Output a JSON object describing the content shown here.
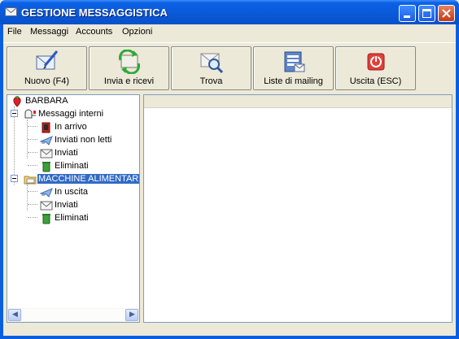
{
  "window": {
    "title": "GESTIONE MESSAGGISTICA",
    "icon": "envelope-icon",
    "controls": [
      "minimize-icon",
      "maximize-icon",
      "close-icon"
    ]
  },
  "menu": {
    "items": [
      {
        "label": "File"
      },
      {
        "label": "Messaggi"
      },
      {
        "label": "Accounts"
      },
      {
        "label": "Opzioni"
      }
    ]
  },
  "toolbar": {
    "buttons": [
      {
        "label": "Nuovo (F4)",
        "icon": "new-message-icon"
      },
      {
        "label": "Invia e ricevi",
        "icon": "send-receive-icon"
      },
      {
        "label": "Trova",
        "icon": "find-icon"
      },
      {
        "label": "Liste di mailing",
        "icon": "mailing-list-icon"
      },
      {
        "label": "Uscita (ESC)",
        "icon": "exit-icon"
      }
    ]
  },
  "tree": {
    "root": {
      "label": "BARBARA",
      "icon": "strawberry-icon"
    },
    "groups": [
      {
        "label": "Messaggi interni",
        "icon": "mailbox-icon",
        "expanded": true,
        "selected": false,
        "children": [
          {
            "label": "In arrivo",
            "icon": "inbox-icon"
          },
          {
            "label": "Inviati non letti",
            "icon": "sent-unread-icon"
          },
          {
            "label": "Inviati",
            "icon": "sent-icon"
          },
          {
            "label": "Eliminati",
            "icon": "deleted-icon"
          }
        ]
      },
      {
        "label": "MACCHINE ALIMENTAR",
        "icon": "account-folder-icon",
        "expanded": true,
        "selected": true,
        "children": [
          {
            "label": "In uscita",
            "icon": "outbox-icon"
          },
          {
            "label": "Inviati",
            "icon": "sent-icon"
          },
          {
            "label": "Eliminati",
            "icon": "deleted-icon"
          }
        ]
      }
    ]
  },
  "colors": {
    "titlebar": "#0A58D8",
    "selection": "#316AC5",
    "face": "#ECE9D8"
  }
}
